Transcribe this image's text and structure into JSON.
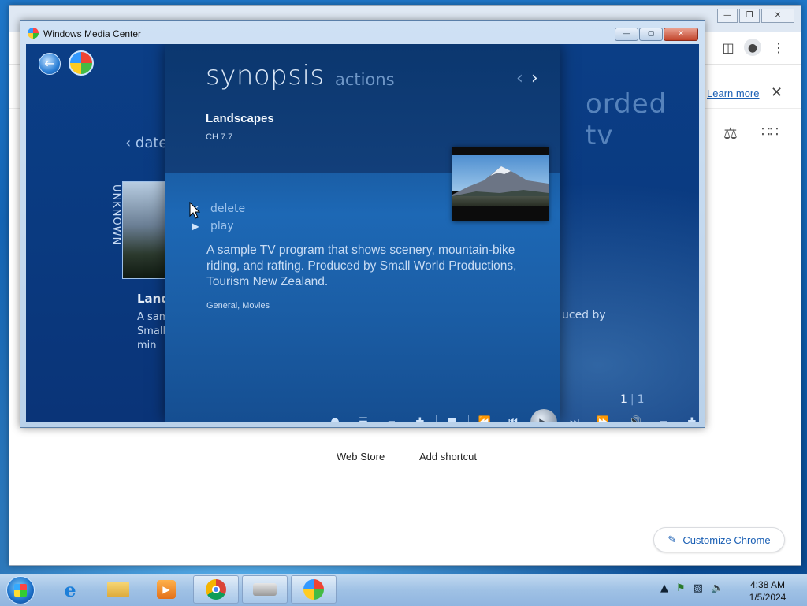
{
  "chrome": {
    "learn_more": "Learn more",
    "tiles": [
      {
        "label": "Web Store"
      },
      {
        "label": "Add shortcut"
      }
    ],
    "customize_label": "Customize Chrome"
  },
  "wmc": {
    "window_title": "Windows Media Center",
    "background": {
      "date_nav": "date",
      "unknown_label": "UNKNOWN",
      "item_title": "Land",
      "item_desc": "A sam Small 1 min",
      "recorded_label": "orded tv",
      "produced_by": "uced by"
    },
    "panel": {
      "tab_active": "synopsis",
      "tab_inactive": "actions",
      "program_title": "Landscapes",
      "channel": "CH 7.7",
      "actions": [
        {
          "label": "delete",
          "icon": "x-icon"
        },
        {
          "label": "play",
          "icon": "play-icon"
        }
      ],
      "synopsis": "A sample TV program that shows scenery, mountain-bike riding, and rafting. Produced by Small World Productions, Tourism New Zealand.",
      "genres": "General, Movies"
    },
    "page_indicator": {
      "current": "1",
      "total": "1"
    }
  },
  "taskbar": {
    "clock_time": "4:38 AM",
    "clock_date": "1/5/2024",
    "items": [
      "internet-explorer-icon",
      "file-explorer-icon",
      "media-player-icon",
      "chrome-icon",
      "scanner-icon",
      "media-center-icon"
    ]
  }
}
